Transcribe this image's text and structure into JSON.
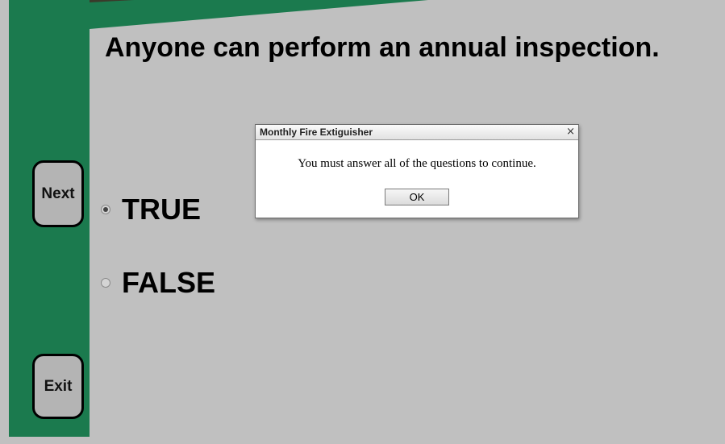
{
  "question": {
    "text": "Anyone can perform an annual inspection."
  },
  "nav": {
    "next_label": "Next",
    "exit_label": "Exit"
  },
  "options": [
    {
      "label": "TRUE",
      "selected": true
    },
    {
      "label": "FALSE",
      "selected": false
    }
  ],
  "dialog": {
    "title": "Monthly Fire Extiguisher",
    "close_glyph": "×",
    "message": "You must answer all of the questions to continue.",
    "ok_label": "OK"
  },
  "colors": {
    "sidebar": "#1b7a4e",
    "background": "#c0c0c0",
    "button_fill": "#b4b4b4"
  }
}
